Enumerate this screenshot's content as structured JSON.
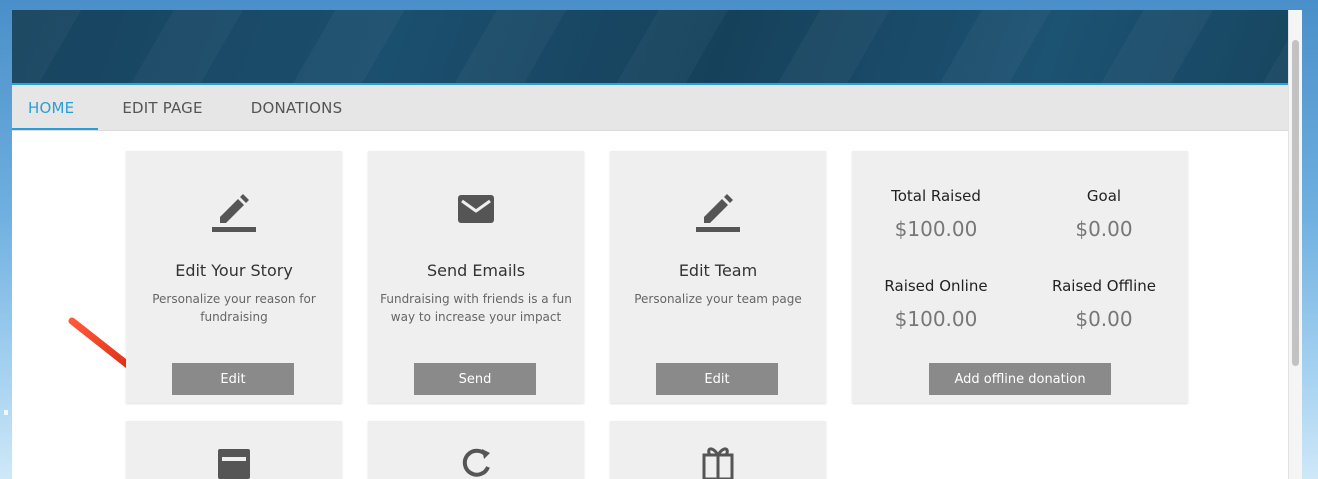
{
  "tabs": [
    {
      "label": "HOME",
      "active": true
    },
    {
      "label": "EDIT PAGE",
      "active": false
    },
    {
      "label": "DONATIONS",
      "active": false
    }
  ],
  "cards": [
    {
      "icon": "pencil-icon",
      "title": "Edit Your Story",
      "description": "Personalize your reason for fundraising",
      "button": "Edit"
    },
    {
      "icon": "envelope-icon",
      "title": "Send Emails",
      "description": "Fundraising with friends is a fun way to increase your impact",
      "button": "Send"
    },
    {
      "icon": "pencil-icon",
      "title": "Edit Team",
      "description": "Personalize your team page",
      "button": "Edit"
    }
  ],
  "stats": {
    "total_raised_label": "Total Raised",
    "total_raised_value": "$100.00",
    "goal_label": "Goal",
    "goal_value": "$0.00",
    "raised_online_label": "Raised Online",
    "raised_online_value": "$100.00",
    "raised_offline_label": "Raised Offline",
    "raised_offline_value": "$0.00",
    "button": "Add offline donation"
  },
  "lower_cards": [
    {
      "icon": "calendar-icon"
    },
    {
      "icon": "refresh-icon"
    },
    {
      "icon": "gift-icon"
    }
  ],
  "colors": {
    "accent": "#2a9fd6",
    "banner": "#1b4f6e",
    "button": "#8a8a8a",
    "arrow": "#e8391f"
  }
}
